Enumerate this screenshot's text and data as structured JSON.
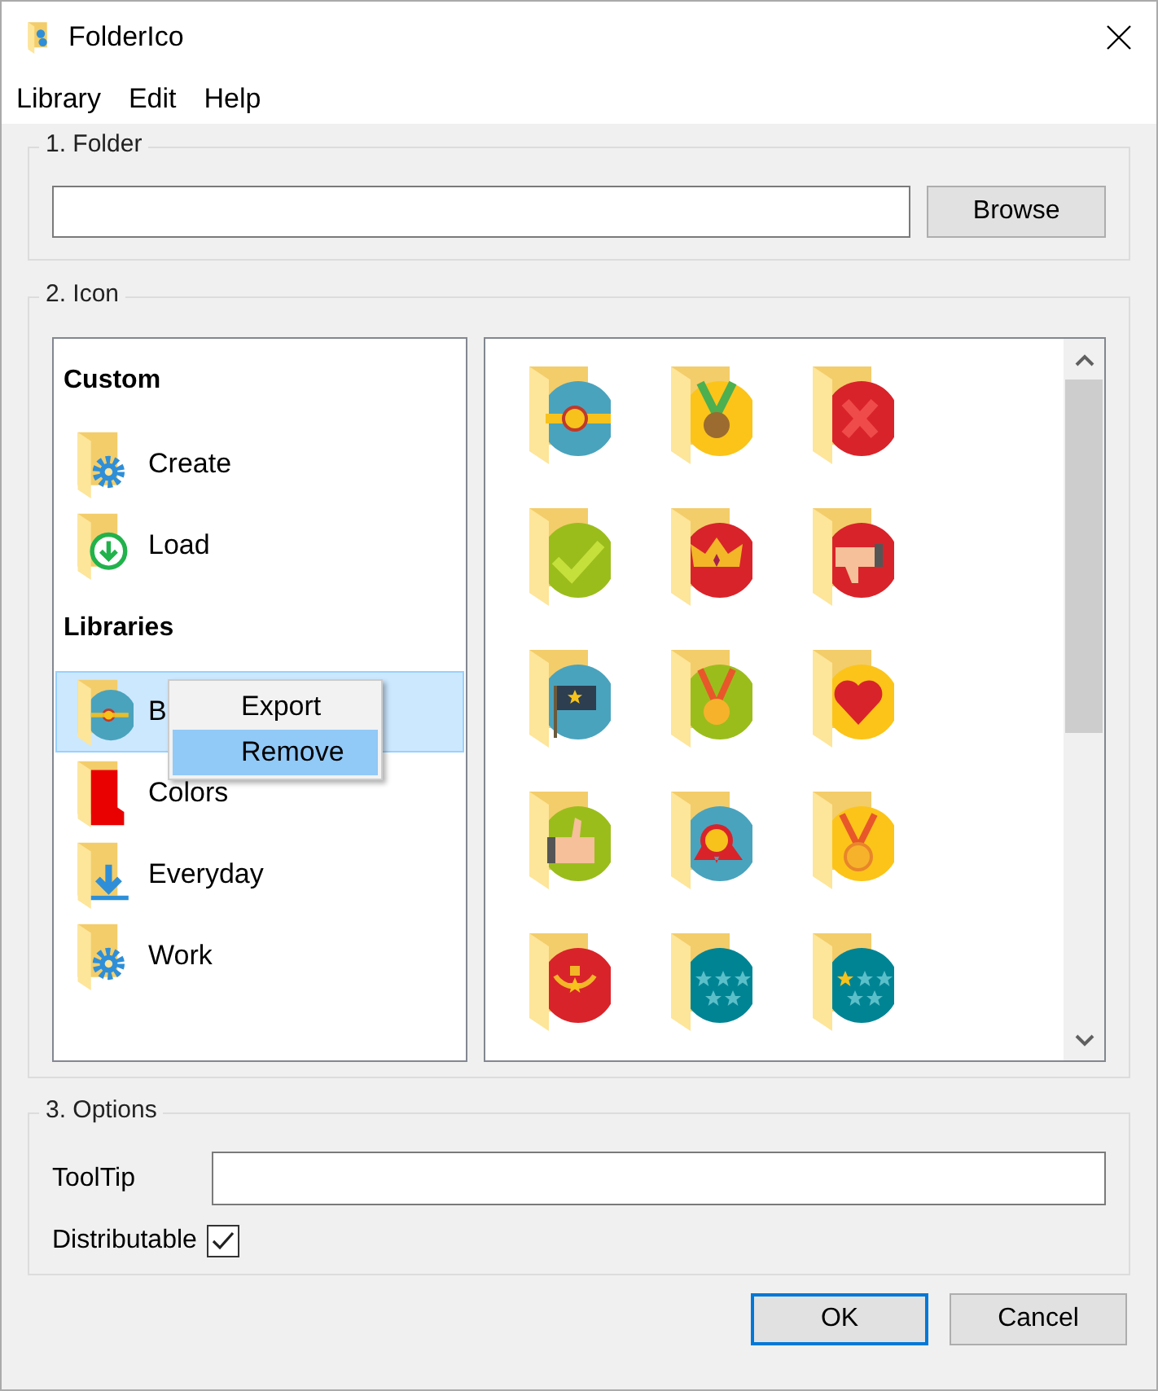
{
  "window": {
    "title": "FolderIco"
  },
  "menu": [
    "Library",
    "Edit",
    "Help"
  ],
  "folder": {
    "label": "1. Folder",
    "browse": "Browse"
  },
  "icon": {
    "label": "2. Icon",
    "sections": [
      {
        "heading": "Custom",
        "items": [
          {
            "label": "Create",
            "selected": false
          },
          {
            "label": "Load",
            "selected": false
          }
        ]
      },
      {
        "heading": "Libraries",
        "items": [
          {
            "label": "B",
            "selected": true
          },
          {
            "label": "Colors",
            "selected": false
          },
          {
            "label": "Everyday",
            "selected": false
          },
          {
            "label": "Work",
            "selected": false
          }
        ]
      }
    ]
  },
  "context_menu": {
    "items": [
      {
        "label": "Export",
        "selected": false
      },
      {
        "label": "Remove",
        "selected": true
      }
    ]
  },
  "options": {
    "label": "3. Options",
    "tooltip_label": "ToolTip",
    "distributable": {
      "label": "Distributable",
      "checked": true
    }
  },
  "buttons": [
    {
      "label": "OK",
      "default": true
    },
    {
      "label": "Cancel",
      "default": false
    }
  ]
}
